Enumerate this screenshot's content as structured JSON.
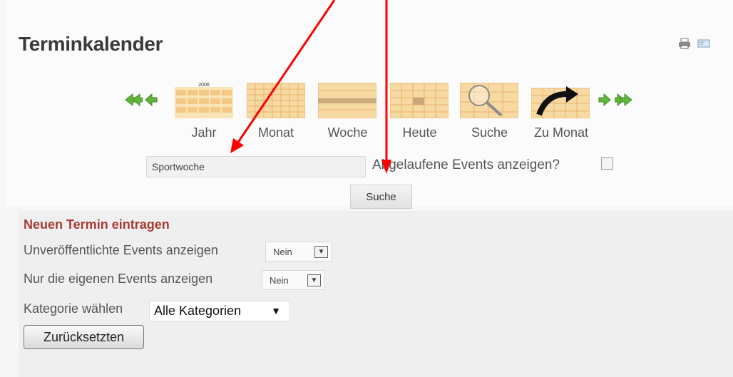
{
  "page": {
    "title": "Terminkalender",
    "icons": [
      "print-icon",
      "mail-icon"
    ]
  },
  "navigation": {
    "arrows": [
      "fast-back-icon",
      "back-icon",
      "forward-icon",
      "fast-forward-icon"
    ],
    "views": [
      {
        "label": "Jahr",
        "icon": "year-calendar-icon",
        "icon_text": "2006"
      },
      {
        "label": "Monat",
        "icon": "month-calendar-icon"
      },
      {
        "label": "Woche",
        "icon": "week-calendar-icon"
      },
      {
        "label": "Heute",
        "icon": "today-calendar-icon"
      },
      {
        "label": "Suche",
        "icon": "search-calendar-icon"
      },
      {
        "label": "Zu Monat",
        "icon": "jump-to-month-icon"
      }
    ]
  },
  "search": {
    "value": "Sportwoche",
    "expired_label": "Abgelaufene Events anzeigen?",
    "expired_checked": false,
    "button": "Suche"
  },
  "new_event": {
    "title": "Neuen Termin eintragen",
    "unpublished_label": "Unveröffentlichte Events anzeigen",
    "unpublished_value": "Nein",
    "own_label": "Nur die eigenen Events anzeigen",
    "own_value": "Nein",
    "category_label": "Kategorie wählen",
    "category_value": "Alle Kategorien",
    "reset_button": "Zurücksetzten"
  },
  "colors": {
    "title": "#3a3a3a",
    "section_title": "#a63b33",
    "nav_arrows": "#55aa33",
    "calendar_fill": "#f6d49a",
    "annotation_arrows": "#ff0000"
  }
}
